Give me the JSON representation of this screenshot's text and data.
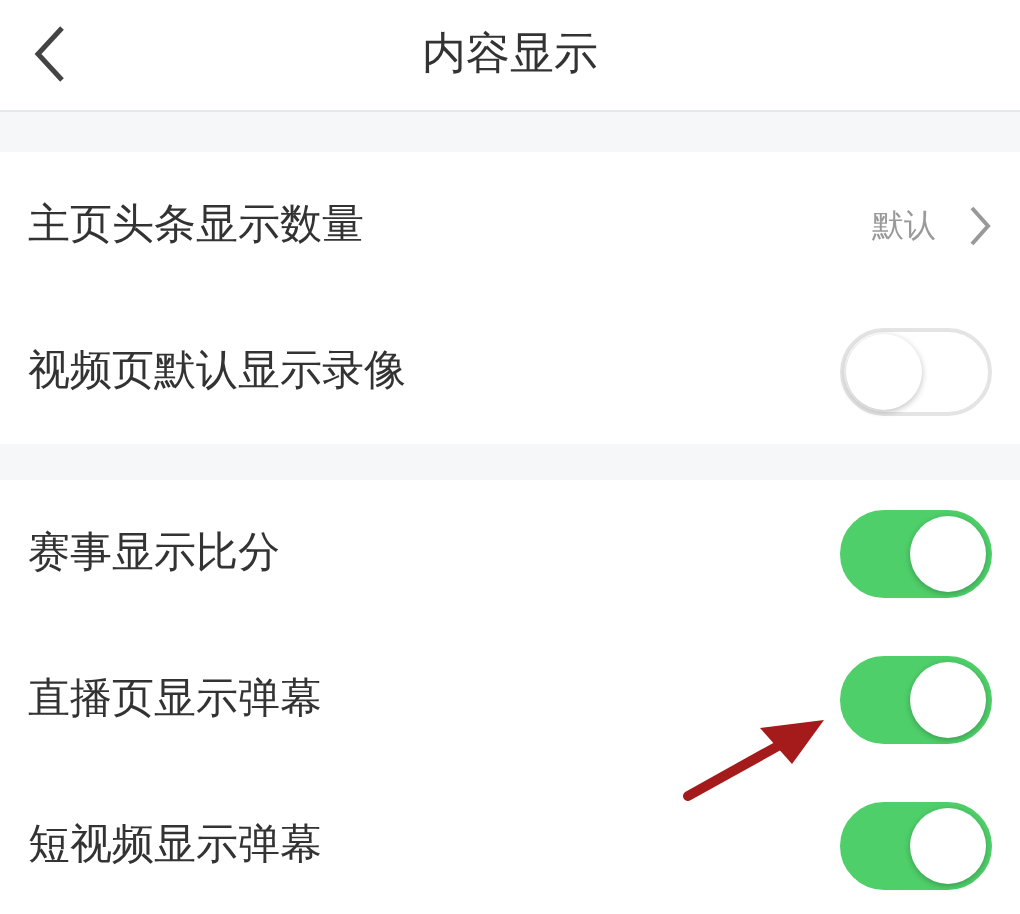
{
  "header": {
    "title": "内容显示"
  },
  "sections": [
    {
      "rows": [
        {
          "kind": "link",
          "label": "主页头条显示数量",
          "value": "默认"
        },
        {
          "kind": "switch",
          "label": "视频页默认显示录像",
          "on": false
        }
      ]
    },
    {
      "rows": [
        {
          "kind": "switch",
          "label": "赛事显示比分",
          "on": true
        },
        {
          "kind": "switch",
          "label": "直播页显示弹幕",
          "on": true
        },
        {
          "kind": "switch",
          "label": "短视频显示弹幕",
          "on": true
        }
      ]
    }
  ],
  "annotation": {
    "kind": "arrow"
  }
}
